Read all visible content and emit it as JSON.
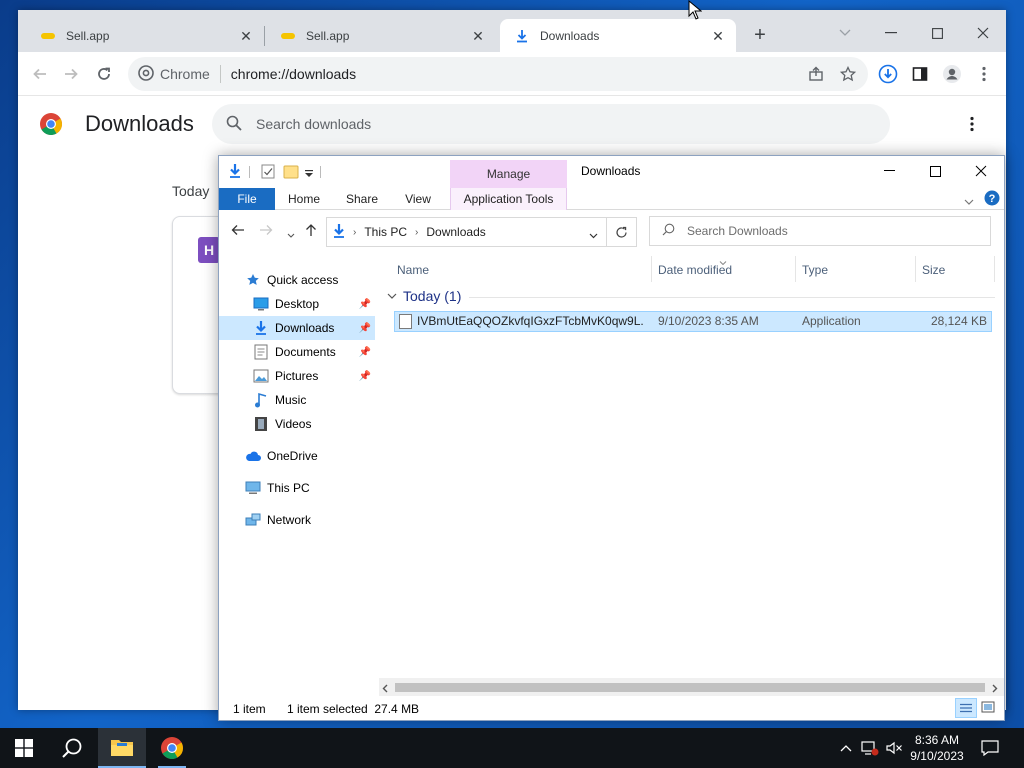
{
  "chrome": {
    "tabs": [
      {
        "label": "Sell.app"
      },
      {
        "label": "Sell.app"
      },
      {
        "label": "Downloads"
      }
    ],
    "omnibox": {
      "chip": "Chrome",
      "url": "chrome://downloads"
    },
    "downloads_page": {
      "title": "Downloads",
      "search_placeholder": "Search downloads",
      "group_label": "Today",
      "card_icon_letter": "H"
    }
  },
  "explorer": {
    "manage_label": "Manage",
    "title": "Downloads",
    "ribbon_tabs": [
      "File",
      "Home",
      "Share",
      "View",
      "Application Tools"
    ],
    "breadcrumb": [
      "This PC",
      "Downloads"
    ],
    "search_placeholder": "Search Downloads",
    "nav": [
      {
        "label": "Quick access"
      },
      {
        "label": "Desktop"
      },
      {
        "label": "Downloads"
      },
      {
        "label": "Documents"
      },
      {
        "label": "Pictures"
      },
      {
        "label": "Music"
      },
      {
        "label": "Videos"
      },
      {
        "label": "OneDrive"
      },
      {
        "label": "This PC"
      },
      {
        "label": "Network"
      }
    ],
    "columns": [
      "Name",
      "Date modified",
      "Type",
      "Size"
    ],
    "group": "Today (1)",
    "files": [
      {
        "name": "IVBmUtEaQQOZkvfqIGxzFTcbMvK0qw9L...",
        "date_modified": "9/10/2023 8:35 AM",
        "type": "Application",
        "size": "28,124 KB"
      }
    ],
    "status": {
      "count": "1 item",
      "selection": "1 item selected  27.4 MB"
    }
  },
  "taskbar": {
    "time": "8:36 AM",
    "date": "9/10/2023"
  },
  "colors": {
    "selection": "#cce8ff",
    "file_tab": "#1a6cc2",
    "manage_tab": "#f2d4f7",
    "chrome_tabstrip": "#dee1e6",
    "taskbar": "#101418"
  }
}
